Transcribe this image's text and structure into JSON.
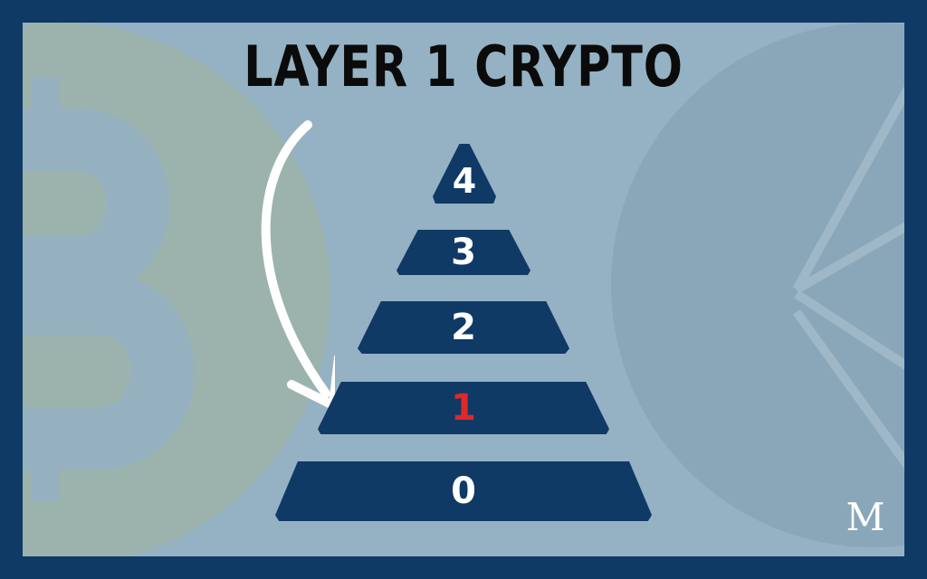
{
  "title": "LAYER 1 CRYPTO",
  "layers": [
    {
      "label": "4",
      "highlighted": false
    },
    {
      "label": "3",
      "highlighted": false
    },
    {
      "label": "2",
      "highlighted": false
    },
    {
      "label": "1",
      "highlighted": true
    },
    {
      "label": "0",
      "highlighted": false
    }
  ],
  "logo_letter": "M",
  "colors": {
    "frame": "#0f3a66",
    "panel": "#95b2c4",
    "layer": "#0f3a66",
    "highlight": "#e0282a",
    "title": "#0b0b0b"
  },
  "icons": {
    "background_left": "bitcoin-icon",
    "background_right": "ethereum-icon",
    "pointer": "curved-arrow-icon"
  }
}
